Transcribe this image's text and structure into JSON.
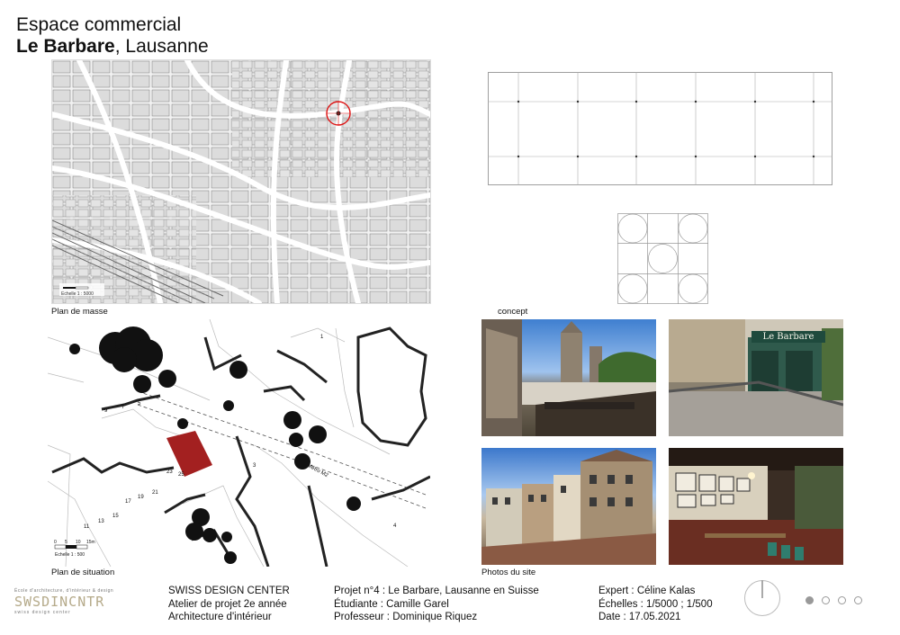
{
  "header": {
    "title_line1": "Espace commercial",
    "title_bold": "Le Barbare",
    "title_rest": ", Lausanne"
  },
  "captions": {
    "plan_masse": "Plan de masse",
    "concept": "concept",
    "plan_situation": "Plan de situation",
    "photos": "Photos du site"
  },
  "map_labels": {
    "scale_masse": "Echelle 1 : 5000",
    "scale_situation": "Echelle 1 : 500",
    "metro": "Métro M2",
    "scale_ticks": [
      "0",
      "5",
      "10",
      "15m"
    ],
    "house_numbers": [
      "9",
      "7",
      "5",
      "23",
      "25",
      "21",
      "19",
      "17",
      "15",
      "13",
      "11",
      "1",
      "3",
      "4"
    ]
  },
  "photo_signs": {
    "le_barbare": "Le Barbare"
  },
  "footer": {
    "logo_tagline": "École d'architecture, d'intérieur & design",
    "logo_text": "SWSDINCNTR",
    "logo_sub": "swiss design center",
    "school": [
      "SWISS DESIGN CENTER",
      "Atelier de projet 2e année",
      "Architecture d'intérieur"
    ],
    "project": [
      "Projet n°4 : Le Barbare, Lausanne en Suisse",
      "Étudiante : Camille Garel",
      "Professeur : Dominique Riquez"
    ],
    "meta": [
      "Expert : Céline Kalas",
      "Échelles : 1/5000 ; 1/500",
      "Date : 17.05.2021"
    ]
  },
  "colors": {
    "site_red": "#a32020",
    "map_line": "#555555",
    "grid_line": "#888888"
  },
  "pagination": {
    "total": 4,
    "active": 1
  }
}
